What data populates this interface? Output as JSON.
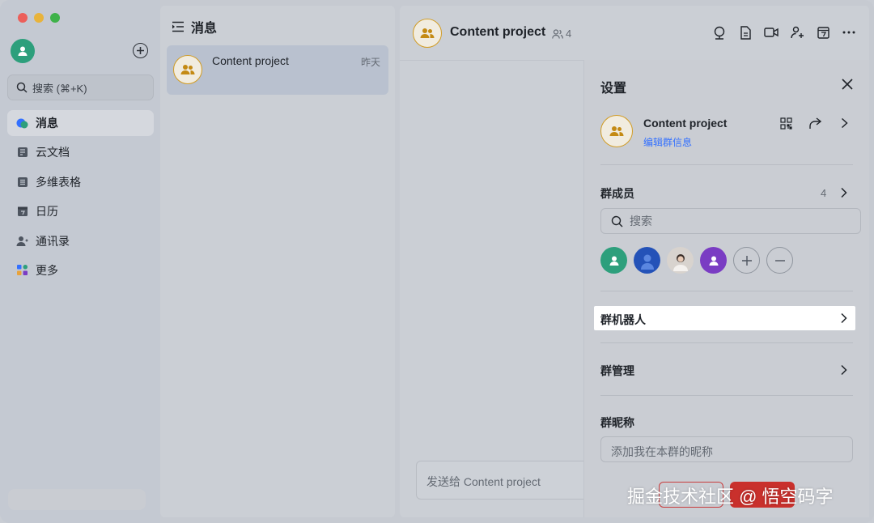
{
  "sidebar": {
    "search_placeholder": "搜索 (⌘+K)",
    "items": [
      {
        "label": "消息",
        "icon": "chat-bubbles-icon",
        "active": true
      },
      {
        "label": "云文档",
        "icon": "docs-icon"
      },
      {
        "label": "多维表格",
        "icon": "table-icon"
      },
      {
        "label": "日历",
        "icon": "calendar-icon"
      },
      {
        "label": "通讯录",
        "icon": "contacts-icon"
      },
      {
        "label": "更多",
        "icon": "apps-grid-icon"
      }
    ]
  },
  "list": {
    "title": "消息",
    "conversations": [
      {
        "name": "Content project",
        "time": "昨天"
      }
    ]
  },
  "chat": {
    "title": "Content project",
    "member_count": "4",
    "input_placeholder": "发送给 Content project"
  },
  "settings": {
    "title": "设置",
    "group_name": "Content project",
    "edit_link": "编辑群信息",
    "members_title": "群成员",
    "members_count": "4",
    "members_search_placeholder": "搜索",
    "bot_label": "群机器人",
    "manage_label": "群管理",
    "nickname_title": "群昵称",
    "nickname_placeholder": "添加我在本群的昵称"
  },
  "watermark": "掘金技术社区 @ 悟空码字",
  "colors": {
    "accent_blue": "#3370ff",
    "group_avatar_ring": "#d19c25",
    "danger_red": "#c9302c"
  }
}
